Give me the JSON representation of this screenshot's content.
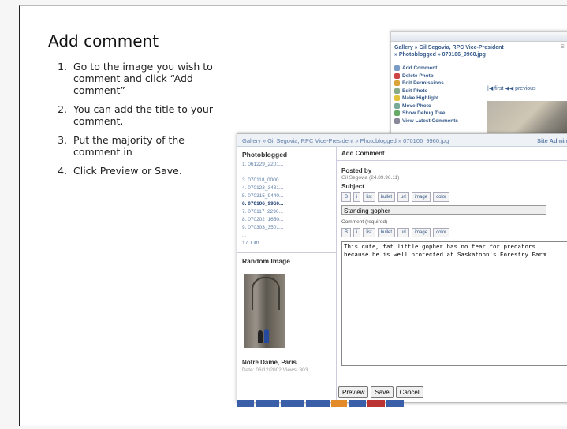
{
  "slide": {
    "title": "Add comment",
    "steps": [
      {
        "num": "1.",
        "text": "Go to the image you wish to comment and click “Add comment”"
      },
      {
        "num": "2.",
        "text": "You can add the title to your comment."
      },
      {
        "num": "3.",
        "text": "Put the majority of the comment in"
      },
      {
        "num": "4.",
        "text": "Click Preview or Save."
      }
    ]
  },
  "back_shot": {
    "breadcrumb1": "Gallery » Gil Segovia, RPC Vice-President",
    "breadcrumb2": "» Photoblogged » 070106_9960.jpg",
    "breadcrumb_right": "Si",
    "menu": [
      "Add Comment",
      "Delete Photo",
      "Edit Permissions",
      "Edit Photo",
      "Make Highlight",
      "Move Photo",
      "Show Debug Tree",
      "View Latest Comments"
    ],
    "nav": "|◀ first  ◀◀ previous",
    "colors": {
      "menu_icons": [
        "#7a9cc4",
        "#c44",
        "#d9a43a",
        "#8a8",
        "#e2c23b",
        "#7a9",
        "#6a6",
        "#889"
      ]
    }
  },
  "front_shot": {
    "breadcrumb": "Gallery » Gil Segovia, RPC Vice-President » Photoblogged » 070106_9960.jpg",
    "admin": "Site Admin",
    "sidebar_title": "Photoblogged",
    "sidebar_items": [
      {
        "label": "1. 061229_2201...",
        "state": "normal"
      },
      {
        "label": "...",
        "state": "gap"
      },
      {
        "label": "3. 070118_0000...",
        "state": "normal"
      },
      {
        "label": "4. 070123_3431...",
        "state": "normal"
      },
      {
        "label": "5. 070315_9440...",
        "state": "normal"
      },
      {
        "label": "6. 070106_9960...",
        "state": "sel"
      },
      {
        "label": "7. 070117_2290...",
        "state": "normal"
      },
      {
        "label": "8. 070202_1650...",
        "state": "normal"
      },
      {
        "label": "9. 070303_3501...",
        "state": "normal"
      },
      {
        "label": "...",
        "state": "gap"
      },
      {
        "label": "17. Lift!",
        "state": "normal"
      }
    ],
    "random_title": "Random Image",
    "random_caption": "Notre Dame, Paris",
    "random_date": "Date: 06/12/2002 Views: 303",
    "main_header": "Add Comment",
    "posted_by_label": "Posted by",
    "posted_by_value": "Gil Segovia (24.89.96.11)",
    "subject_label": "Subject",
    "subject_value": "Standing gopher",
    "comment_label": "Comment (required)",
    "toolbar": [
      "B",
      "i",
      "list",
      "bullet",
      "url",
      "image",
      "color"
    ],
    "comment_text": "This cute, fat little gopher has no fear for predators\nbecause he is well protected at Saskatoon's Forestry Farm",
    "buttons": {
      "preview": "Preview",
      "save": "Save",
      "cancel": "Cancel"
    }
  },
  "taskbar_colors": [
    "#3a5fa8",
    "#3a5fa8",
    "#3a5fa8",
    "#3a5fa8",
    "#e38a2a",
    "#3a5fa8",
    "#b33",
    "#3a5fa8"
  ]
}
